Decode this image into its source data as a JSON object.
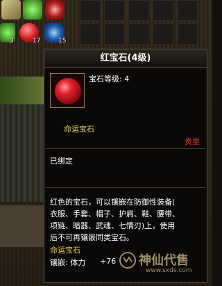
{
  "hotbar": {
    "counts": [
      "3",
      "17",
      "15"
    ]
  },
  "tooltip": {
    "title": "红宝石(4级)",
    "level_text": "宝石等级: 4",
    "category": "命运宝石",
    "rarity": "贵重",
    "bound": "已绑定",
    "description_lines": [
      "红色的宝石，可以镶嵌在防御性装备(",
      "衣服、手套、帽子、护肩、鞋、腰带、",
      "项链、暗器、武魂、七情刃)上，使用",
      "后不可再镶嵌同类宝石。"
    ],
    "category_footer": "命运宝石",
    "inlay_label": "镶嵌: 体力",
    "inlay_value": "+76"
  },
  "watermark": {
    "brand": "神仙代售",
    "url": "www.sxds.com"
  },
  "colors": {
    "title_text": "#ffffff",
    "category": "#e8d25a",
    "rarity": "#d8302a",
    "border": "#5a5448"
  }
}
